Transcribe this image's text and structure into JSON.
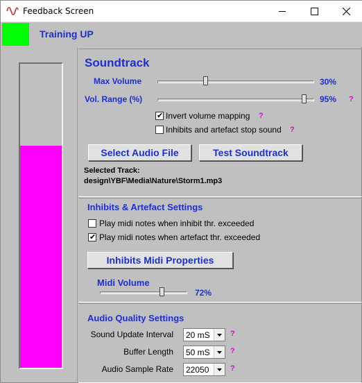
{
  "window": {
    "title": "Feedback Screen"
  },
  "header": {
    "title": "Training UP",
    "status_color": "#00ff00"
  },
  "meter": {
    "fill_color": "#ff00ff",
    "level_fraction": 0.73
  },
  "soundtrack": {
    "title": "Soundtrack",
    "max_volume": {
      "label": "Max Volume",
      "value_text": "30%",
      "value": 0.3
    },
    "vol_range": {
      "label": "Vol. Range (%)",
      "value_text": "95%",
      "value": 0.95,
      "help": "?"
    },
    "invert_volume": {
      "label": "Invert volume mapping",
      "checked": true,
      "help": "?"
    },
    "inhibits_stop": {
      "label": "Inhibits and artefact stop sound",
      "checked": false,
      "help": "?"
    },
    "select_audio_button": "Select Audio File",
    "test_soundtrack_button": "Test Soundtrack",
    "selected_track_label": "Selected Track:",
    "selected_track_path": "design\\YBF\\Media\\Nature\\Storm1.mp3"
  },
  "inhibits": {
    "title": "Inhibits & Artefact Settings",
    "midi_inhibit": {
      "label": "Play midi notes when inhibit thr. exceeded",
      "checked": false
    },
    "midi_artefact": {
      "label": "Play midi notes when artefact thr. exceeded",
      "checked": true
    },
    "midi_properties_button": "Inhibits Midi Properties",
    "midi_volume": {
      "label": "Midi Volume",
      "value_text": "72%",
      "value": 0.72
    }
  },
  "audio_quality": {
    "title": "Audio Quality Settings",
    "sound_update": {
      "label": "Sound Update Interval",
      "value": "20 mS",
      "help": "?"
    },
    "buffer_length": {
      "label": "Buffer Length",
      "value": "50 mS",
      "help": "?"
    },
    "sample_rate": {
      "label": "Audio Sample Rate",
      "value": "22050",
      "help": "?"
    }
  },
  "icons": {
    "app": "waveform-icon",
    "minimize": "minimize-icon",
    "maximize": "maximize-icon",
    "close": "close-icon",
    "dropdown": "chevron-down-icon"
  }
}
